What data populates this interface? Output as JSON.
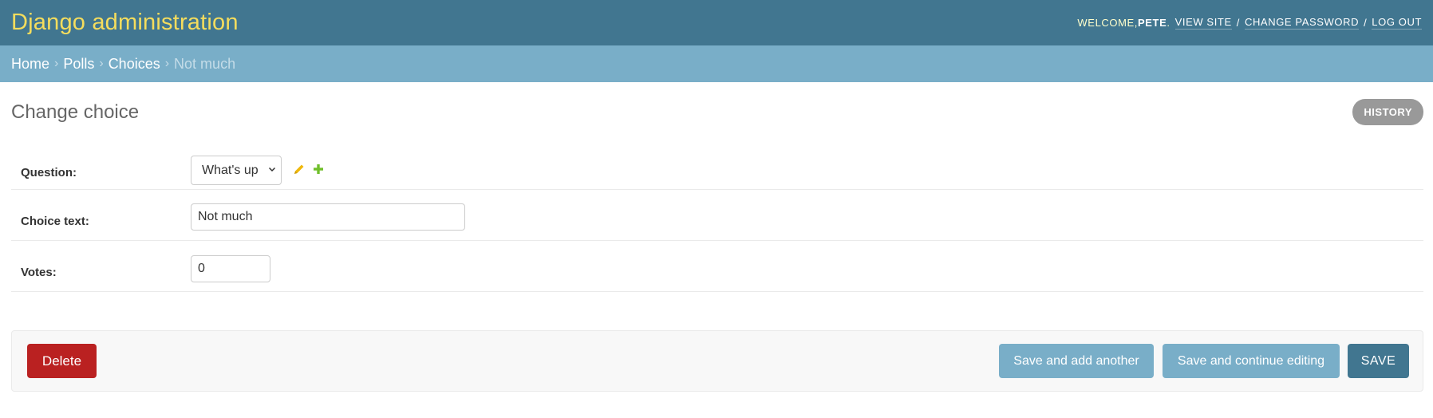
{
  "header": {
    "site_name": "Django administration",
    "welcome": "WELCOME, ",
    "username": "PETE",
    "welcome_suffix": ".",
    "view_site": "VIEW SITE",
    "change_password": "CHANGE PASSWORD",
    "log_out": "LOG OUT",
    "separator": "/"
  },
  "breadcrumbs": {
    "items": [
      "Home",
      "Polls",
      "Choices"
    ],
    "current": "Not much",
    "separator": "›"
  },
  "page": {
    "title": "Change choice",
    "history_label": "HISTORY"
  },
  "form": {
    "question": {
      "label": "Question:",
      "value": "What's up"
    },
    "choice_text": {
      "label": "Choice text:",
      "value": "Not much"
    },
    "votes": {
      "label": "Votes:",
      "value": "0"
    }
  },
  "submit": {
    "delete_label": "Delete",
    "save_add_label": "Save and add another",
    "save_continue_label": "Save and continue editing",
    "save_label": "SAVE"
  },
  "colors": {
    "header_bg": "#417690",
    "site_name": "#f5dd5d",
    "breadcrumb_bg": "#79aec8",
    "delete_bg": "#ba2121",
    "secondary_btn_bg": "#79aec8",
    "primary_btn_bg": "#417690",
    "edit_icon": "#efb80b",
    "add_icon": "#70bf2b"
  },
  "icons": {
    "edit": "pencil-icon",
    "add": "plus-icon",
    "select": "chevron-down-icon"
  }
}
